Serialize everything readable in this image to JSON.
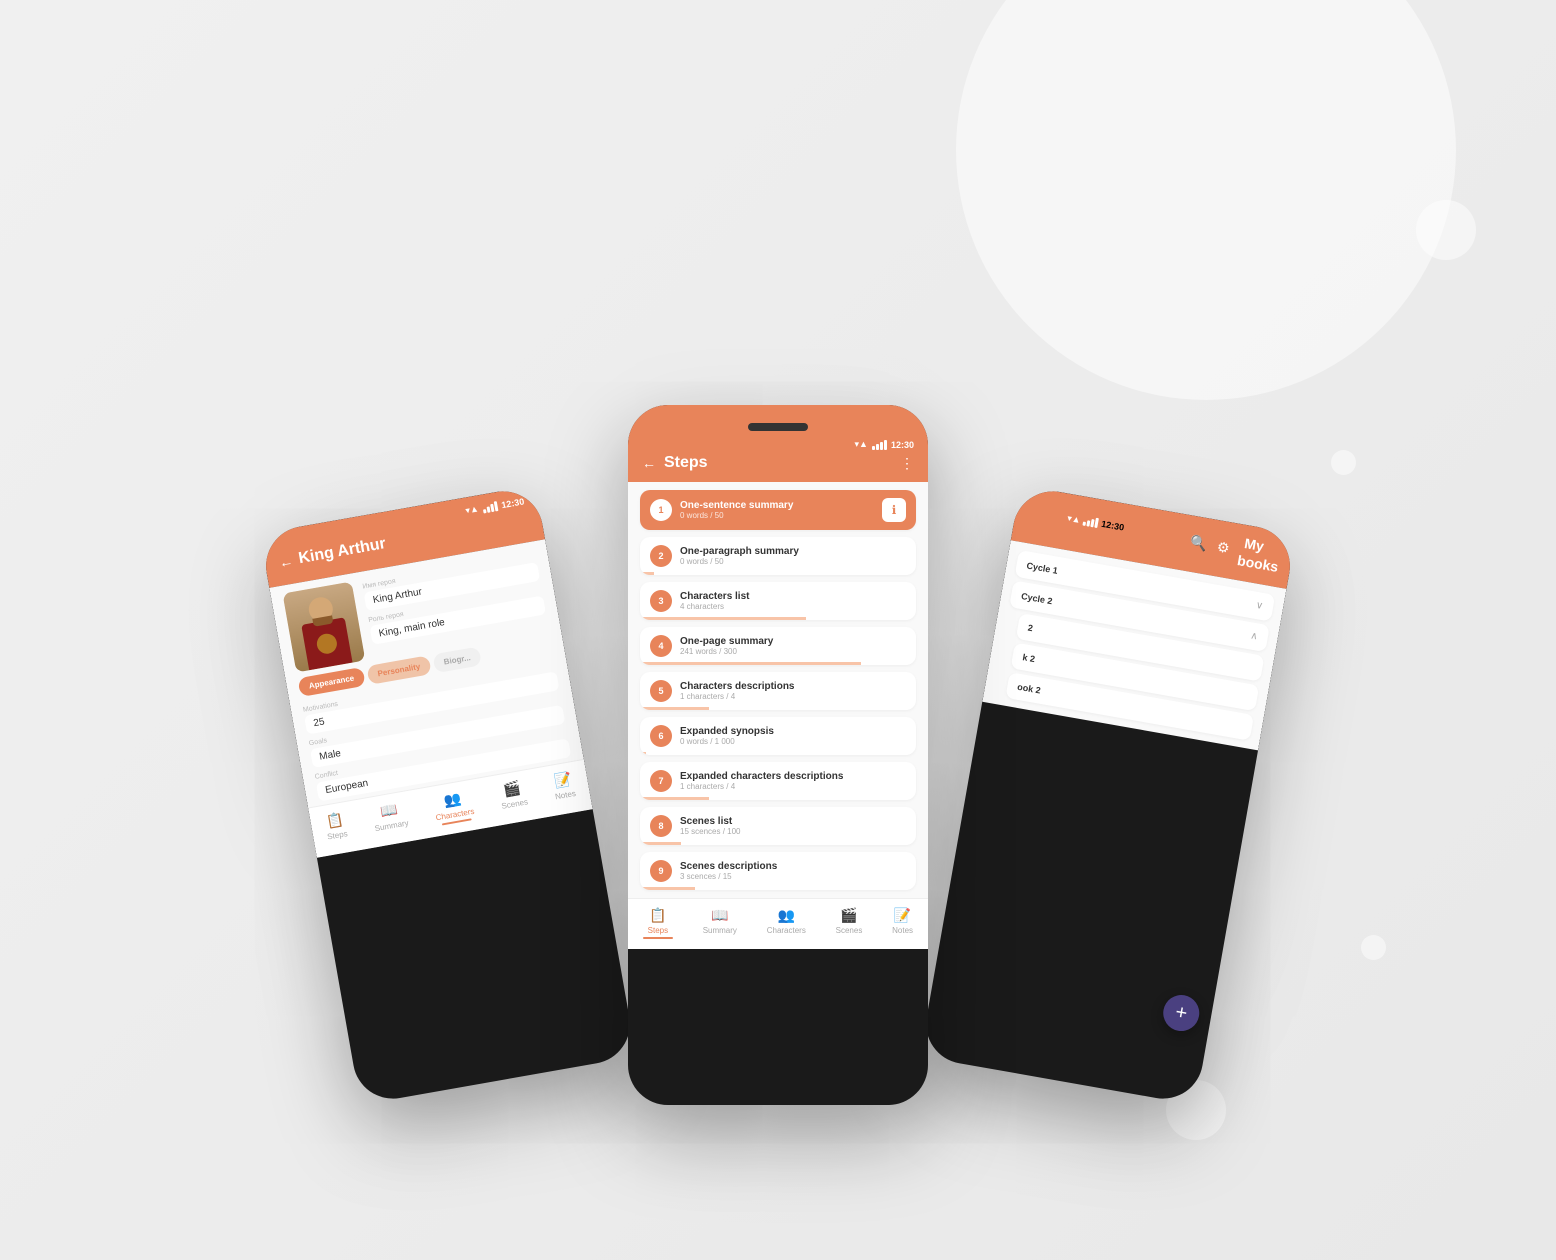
{
  "background": {
    "colors": [
      "#f0f0f0",
      "#e8e8e8"
    ]
  },
  "phones": {
    "left": {
      "title": "King Arthur",
      "back_label": "←",
      "status_time": "12:30",
      "character": {
        "name": "King Arthur",
        "name_label": "Имя героя",
        "role": "King, main role",
        "role_label": "Роль героя"
      },
      "tabs": [
        "Appearance",
        "Personality",
        "Biogr..."
      ],
      "fields": [
        {
          "label": "Motivations",
          "value": "25"
        },
        {
          "label": "Goals",
          "value": "Male"
        },
        {
          "label": "Conflict",
          "value": "European"
        }
      ],
      "nav": {
        "items": [
          "Steps",
          "Summary",
          "Characters",
          "Scenes",
          "Notes"
        ],
        "active": "Characters"
      }
    },
    "center": {
      "title": "Steps",
      "status_time": "12:30",
      "more_icon": "⋮",
      "back_label": "←",
      "steps": [
        {
          "number": "1",
          "title": "One-sentence summary",
          "subtitle": "0 words / 50",
          "progress": 0,
          "active": true
        },
        {
          "number": "2",
          "title": "One-paragraph summary",
          "subtitle": "0 words / 50",
          "progress": 5
        },
        {
          "number": "3",
          "title": "Characters list",
          "subtitle": "4 characters",
          "progress": 60
        },
        {
          "number": "4",
          "title": "One-page summary",
          "subtitle": "241 words / 300",
          "progress": 80
        },
        {
          "number": "5",
          "title": "Characters descriptions",
          "subtitle": "1 characters / 4",
          "progress": 25
        },
        {
          "number": "6",
          "title": "Expanded synopsis",
          "subtitle": "0 words / 1 000",
          "progress": 0
        },
        {
          "number": "7",
          "title": "Expanded characters descriptions",
          "subtitle": "1 characters / 4",
          "progress": 25
        },
        {
          "number": "8",
          "title": "Scenes list",
          "subtitle": "15 scences / 100",
          "progress": 15
        },
        {
          "number": "9",
          "title": "Scenes descriptions",
          "subtitle": "3 scences / 15",
          "progress": 20
        }
      ],
      "nav": {
        "items": [
          "Steps",
          "Summary",
          "Characters",
          "Scenes",
          "Notes"
        ],
        "active": "Steps"
      }
    },
    "right": {
      "title": "My books",
      "status_time": "12:30",
      "books": [
        {
          "title": "Cycle 1"
        },
        {
          "title": "Cycle 2"
        },
        {
          "title": "2"
        },
        {
          "title": "k 2"
        },
        {
          "title": "ook 2"
        }
      ],
      "fab_label": "+"
    }
  }
}
